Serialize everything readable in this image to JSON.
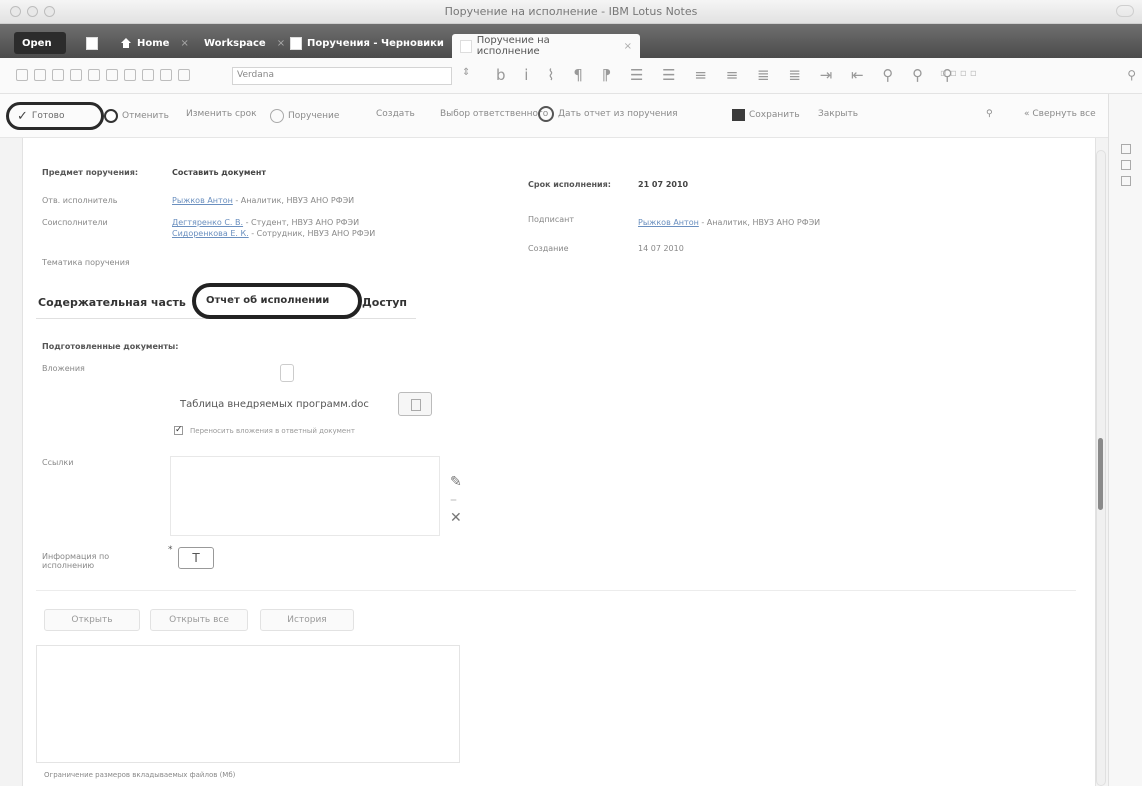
{
  "window": {
    "title": "Поручение на исполнение - IBM Lotus Notes"
  },
  "tabs": {
    "open": "Open",
    "home": "Home",
    "workspace": "Workspace",
    "draft": "Поручения - Черновики",
    "active": "Поручение на исполнение"
  },
  "format_toolbar": {
    "font": "Verdana",
    "marks": "b i ⌇ ¶ ⁋ ☰ ☰ ≡ ≡ ≣ ≣ ⇥ ⇤ ⚲ ⚲ ⚲"
  },
  "actions": {
    "ready": "Готово",
    "reject": "Отменить",
    "change_deadline": "Изменить срок",
    "order": "Поручение",
    "create": "Создать",
    "choose_executor": "Выбор ответственного",
    "give_report": "Дать отчет из поручения",
    "save": "Сохранить",
    "close": "Закрыть",
    "collapse_all": "« Свернуть все"
  },
  "form": {
    "subject_label": "Предмет поручения:",
    "subject_value": "Составить документ",
    "executor_label": "Отв. исполнитель",
    "executor_name": "Рыжков Антон",
    "executor_rest": "- Аналитик, НВУЗ АНО РФЭИ",
    "coexec_label": "Соисполнители",
    "coexec_1_name": "Дегтяренко С. В.",
    "coexec_1_rest": "- Студент, НВУЗ АНО РФЭИ",
    "coexec_2_name": "Сидоренкова Е. К.",
    "coexec_2_rest": "- Сотрудник, НВУЗ АНО РФЭИ",
    "topic_label": "Тематика поручения",
    "deadline_label": "Срок исполнения:",
    "deadline_value": "21 07 2010",
    "signed_label": "Подписант",
    "signed_name": "Рыжков Антон",
    "signed_rest": "- Аналитик, НВУЗ АНО РФЭИ",
    "created_label": "Создание",
    "created_value": "14 07 2010"
  },
  "form_tabs": {
    "content": "Содержательная часть",
    "report": "Отчет об исполнении",
    "access": "Доступ"
  },
  "report": {
    "prepared_label": "Подготовленные документы:",
    "attachments_label": "Вложения",
    "file_name": "Таблица внедряемых программ.doc",
    "copy_label": "Переносить вложения в ответный документ",
    "refs_label": "Ссылки",
    "info_label_1": "Информация по",
    "info_label_2": "исполнению",
    "info_btn": "T"
  },
  "buttons": {
    "open": "Открыть",
    "open_all": "Открыть все",
    "history": "История"
  },
  "bottom": {
    "limit_label": "Ограничение размеров вкладываемых файлов (Мб)"
  }
}
